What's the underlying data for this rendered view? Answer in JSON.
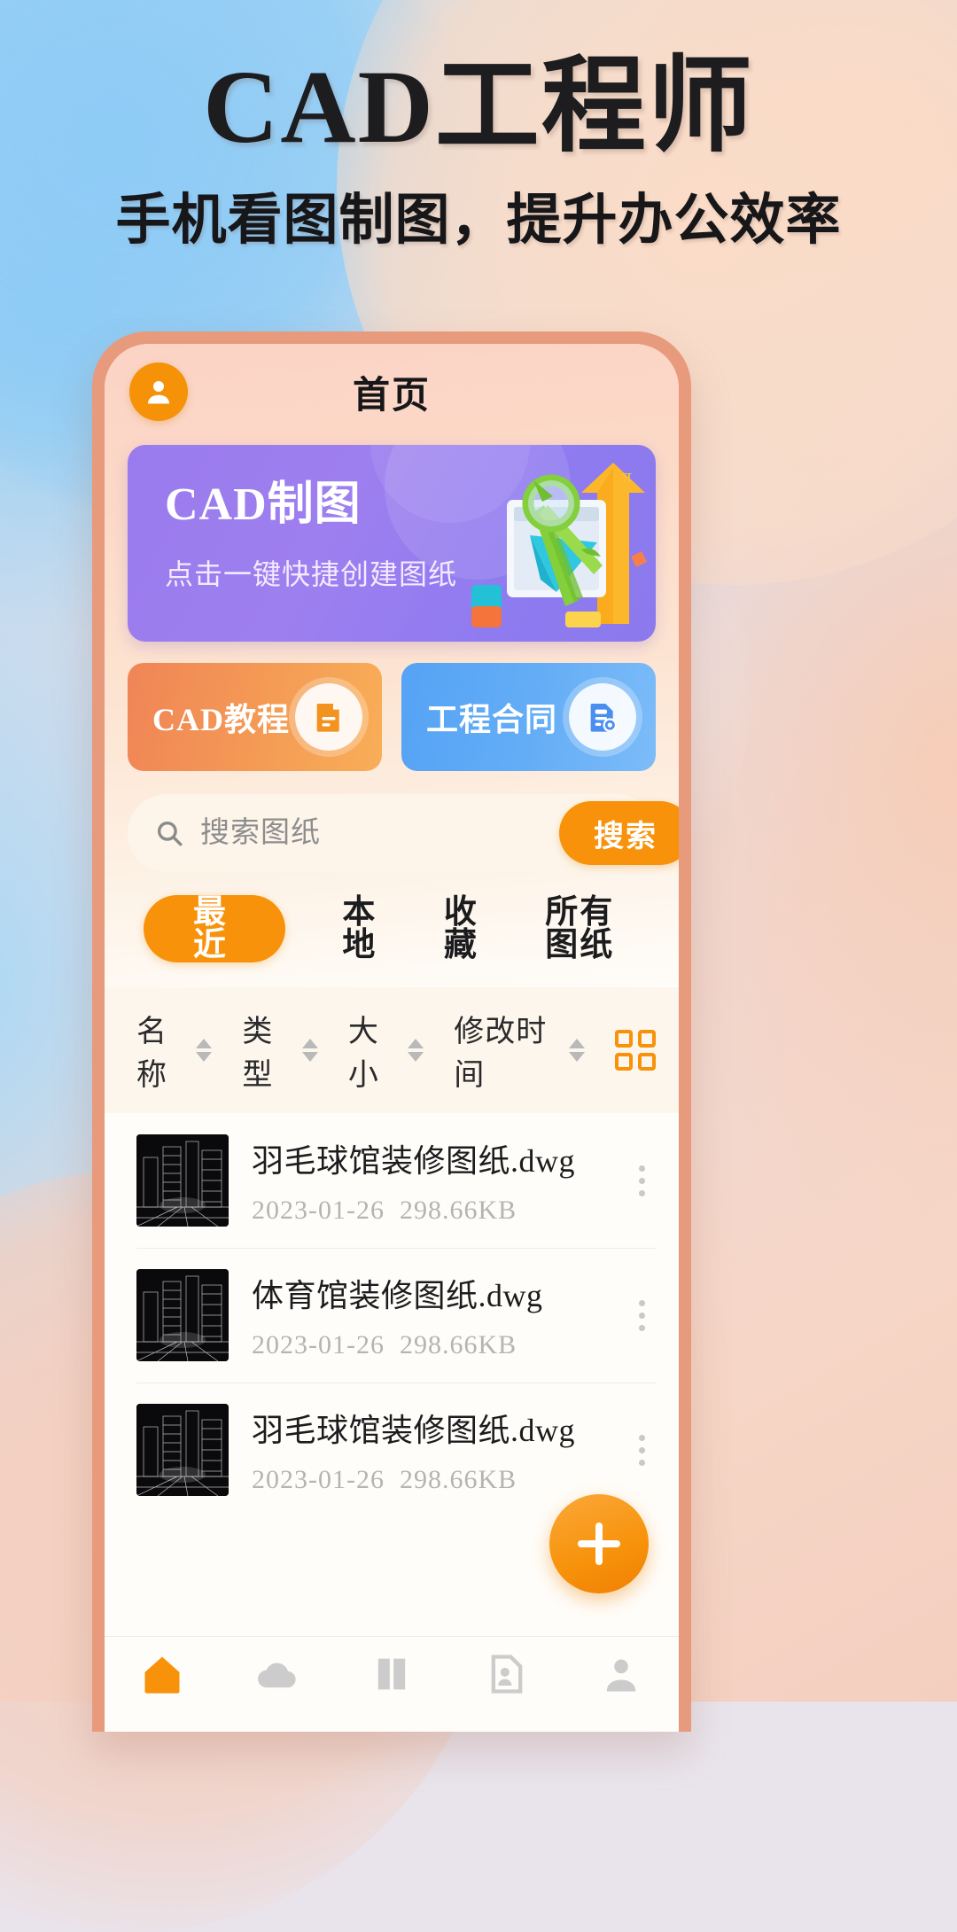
{
  "poster": {
    "title": "CAD工程师",
    "subtitle": "手机看图制图，提升办公效率"
  },
  "colors": {
    "accent_orange": "#f7920a",
    "banner_purple": "#9a7bee",
    "card_orange": "#f08557",
    "card_blue": "#55a3f5",
    "phone_frame": "#e89a7c",
    "muted_text": "#b4b4b4"
  },
  "app": {
    "header": {
      "avatar_icon": "user-icon",
      "title": "首页"
    },
    "banner": {
      "title": "CAD制图",
      "subtitle": "点击一键快捷创建图纸",
      "illustration": "compass-drawing-illustration"
    },
    "feature_cards": [
      {
        "label": "CAD教程",
        "icon": "document-icon",
        "theme": "orange"
      },
      {
        "label": "工程合同",
        "icon": "contract-icon",
        "theme": "blue"
      }
    ],
    "search": {
      "icon": "search-icon",
      "placeholder": "搜索图纸",
      "value": "",
      "button_label": "搜索"
    },
    "tabs": [
      {
        "label": "最近",
        "active": true
      },
      {
        "label": "本地",
        "active": false
      },
      {
        "label": "收藏",
        "active": false
      },
      {
        "label": "所有图纸",
        "active": false
      }
    ],
    "columns": [
      {
        "label": "名称",
        "sortable": true
      },
      {
        "label": "类型",
        "sortable": true
      },
      {
        "label": "大小",
        "sortable": true
      },
      {
        "label": "修改时间",
        "sortable": true
      }
    ],
    "view_toggle_icon": "grid-view-icon",
    "files": [
      {
        "name": "羽毛球馆装修图纸.dwg",
        "date": "2023-01-26",
        "size": "298.66KB",
        "thumbnail": "cad-wireframe-thumbnail",
        "menu_icon": "more-vertical-icon"
      },
      {
        "name": "体育馆装修图纸.dwg",
        "date": "2023-01-26",
        "size": "298.66KB",
        "thumbnail": "cad-wireframe-thumbnail",
        "menu_icon": "more-vertical-icon"
      },
      {
        "name": "羽毛球馆装修图纸.dwg",
        "date": "2023-01-26",
        "size": "298.66KB",
        "thumbnail": "cad-wireframe-thumbnail",
        "menu_icon": "more-vertical-icon"
      }
    ],
    "fab": {
      "icon": "plus-icon"
    },
    "bottom_nav": [
      {
        "icon": "home-icon",
        "active": true
      },
      {
        "icon": "cloud-icon",
        "active": false
      },
      {
        "icon": "book-icon",
        "active": false
      },
      {
        "icon": "file-user-icon",
        "active": false
      },
      {
        "icon": "person-icon",
        "active": false
      }
    ]
  }
}
